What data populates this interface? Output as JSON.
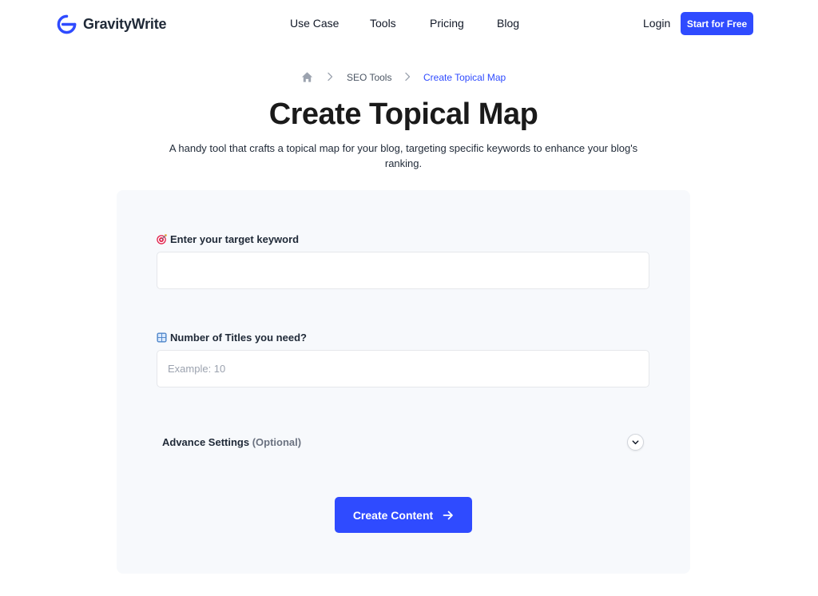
{
  "brand": {
    "name": "GravityWrite",
    "accent": "#2f4bff"
  },
  "nav": {
    "items": [
      "Use Case",
      "Tools",
      "Pricing",
      "Blog"
    ],
    "login": "Login",
    "cta": "Start for Free"
  },
  "breadcrumb": {
    "home_icon": "home-icon",
    "items": [
      "SEO Tools",
      "Create Topical Map"
    ]
  },
  "page": {
    "title": "Create Topical Map",
    "subtitle": "A handy tool that crafts a topical map for your blog, targeting specific keywords to enhance your blog's ranking."
  },
  "form": {
    "keyword": {
      "label": "Enter your target keyword",
      "icon": "target-icon",
      "value": "",
      "placeholder": ""
    },
    "titles": {
      "label": "Number of Titles you need?",
      "icon": "numbers-icon",
      "value": "",
      "placeholder": "Example: 10"
    },
    "advance": {
      "label": "Advance Settings",
      "optional": "(Optional)",
      "icon": "chevron-down-icon"
    },
    "submit": {
      "label": "Create Content",
      "icon": "arrow-right-icon"
    }
  }
}
